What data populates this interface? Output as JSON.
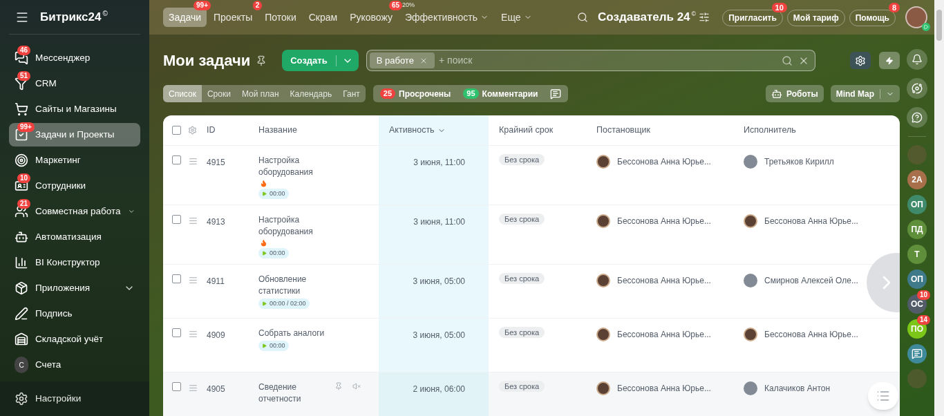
{
  "sidebar": {
    "logo": "Битрикс24",
    "logo_mark": "©",
    "items": [
      {
        "label": "Мессенджер",
        "badge": "46",
        "selected": false,
        "expandable": false
      },
      {
        "label": "CRM",
        "badge": "51",
        "selected": false,
        "expandable": false
      },
      {
        "label": "Сайты и Магазины",
        "selected": false,
        "expandable": false
      },
      {
        "label": "Задачи и Проекты",
        "badge": "99+",
        "selected": true,
        "expandable": false
      },
      {
        "label": "Маркетинг",
        "selected": false,
        "expandable": false
      },
      {
        "label": "Сотрудники",
        "badge": "10",
        "selected": false,
        "expandable": false
      },
      {
        "label": "Совместная работа",
        "badge": "21",
        "selected": false,
        "expandable": true
      },
      {
        "label": "Автоматизация",
        "selected": false,
        "expandable": false
      },
      {
        "label": "BI Конструктор",
        "selected": false,
        "expandable": false
      },
      {
        "label": "Приложения",
        "selected": false,
        "expandable": true
      },
      {
        "label": "Подпись",
        "selected": false,
        "expandable": false
      },
      {
        "label": "Складской учёт",
        "selected": false,
        "expandable": false
      },
      {
        "letter": "С",
        "label": "Счета",
        "selected": false,
        "expandable": false
      }
    ],
    "settings": "Настройки"
  },
  "topnav": {
    "tabs": [
      {
        "label": "Задачи",
        "badge": "99+",
        "selected": true,
        "dropdown": false
      },
      {
        "label": "Проекты",
        "badge": "2",
        "selected": false,
        "dropdown": false
      },
      {
        "label": "Потоки",
        "selected": false,
        "dropdown": false
      },
      {
        "label": "Скрам",
        "selected": false,
        "dropdown": false
      },
      {
        "label": "Руковожу",
        "badge": "65",
        "selected": false,
        "dropdown": false
      },
      {
        "label": "Эффективность",
        "note": "20%",
        "selected": false,
        "dropdown": true
      },
      {
        "label": "Еще",
        "selected": false,
        "dropdown": true
      }
    ],
    "company": "Создаватель 24",
    "company_mark": "©",
    "buttons": [
      {
        "label": "Пригласить",
        "badge": "10"
      },
      {
        "label": "Мой тариф"
      },
      {
        "label": "Помощь",
        "badge": "8"
      }
    ]
  },
  "toolbar": {
    "title": "Мои задачи",
    "create": "Создать",
    "filter_chip": "В работе",
    "search_add": "+",
    "search": {
      "placeholder": "поиск"
    },
    "views": [
      {
        "label": "Список",
        "selected": true
      },
      {
        "label": "Сроки",
        "selected": false
      },
      {
        "label": "Мой план",
        "selected": false
      },
      {
        "label": "Календарь",
        "selected": false
      },
      {
        "label": "Гант",
        "selected": false
      }
    ],
    "counters": [
      {
        "count": "25",
        "label": "Просрочены",
        "color": "#f0433f"
      },
      {
        "count": "95",
        "label": "Комментарии",
        "color": "#2fc26e"
      }
    ],
    "robots": "Роботы",
    "mind_map": "Mind Map"
  },
  "table": {
    "select_all": {
      "checked": false
    },
    "columns": [
      {
        "label": "ID",
        "sorted": false
      },
      {
        "label": "Название",
        "sorted": false
      },
      {
        "label": "Активность",
        "sorted": true
      },
      {
        "label": "Крайний срок",
        "sorted": false
      },
      {
        "label": "Постановщик",
        "sorted": false
      },
      {
        "label": "Исполнитель",
        "sorted": false
      }
    ],
    "rows": [
      {
        "checked": false,
        "id": "4915",
        "title": "Настройка оборудования",
        "hot": true,
        "timer": "00:00",
        "activity": "3 июня, 11:00",
        "deadline": "Без срока",
        "creator": {
          "name": "Бессонова Анна Юрье...",
          "photo": true
        },
        "assignee": {
          "name": "Третьяков Кирилл",
          "photo": false
        },
        "highlighted": false
      },
      {
        "checked": false,
        "id": "4913",
        "title": "Настройка оборудования",
        "hot": true,
        "timer": "00:00",
        "activity": "3 июня, 11:00",
        "deadline": "Без срока",
        "creator": {
          "name": "Бессонова Анна Юрье...",
          "photo": true
        },
        "assignee": {
          "name": "Бессонова Анна Юрье...",
          "photo": true
        },
        "highlighted": false
      },
      {
        "checked": false,
        "id": "4911",
        "title": "Обновление статистики",
        "hot": false,
        "timer": "00:00 / 02:00",
        "activity": "3 июня, 05:00",
        "deadline": "Без срока",
        "creator": {
          "name": "Бессонова Анна Юрье...",
          "photo": true
        },
        "assignee": {
          "name": "Смирнов Алексей Оле...",
          "photo": false
        },
        "highlighted": false
      },
      {
        "checked": false,
        "id": "4909",
        "title": "Собрать аналоги",
        "hot": false,
        "timer": "00:00",
        "activity": "3 июня, 05:00",
        "deadline": "Без срока",
        "creator": {
          "name": "Бессонова Анна Юрье...",
          "photo": true
        },
        "assignee": {
          "name": "Бессонова Анна Юрье...",
          "photo": true
        },
        "highlighted": false
      },
      {
        "checked": false,
        "id": "4905",
        "title": "Сведение отчетности",
        "hot": false,
        "activity": "2 июня, 06:00",
        "deadline": "Без срока",
        "creator": {
          "name": "Бессонова Анна Юрье...",
          "photo": true
        },
        "assignee": {
          "name": "Калачиков Антон",
          "photo": false
        },
        "highlighted": true
      }
    ]
  },
  "rail": [
    {
      "kind": "photo"
    },
    {
      "kind": "initials",
      "text": "2А",
      "color": "#a8704a"
    },
    {
      "kind": "initials",
      "text": "ОП",
      "color": "#3f8a6a"
    },
    {
      "kind": "initials",
      "text": "ПД",
      "color": "#5f8f3a"
    },
    {
      "kind": "initials",
      "text": "Т",
      "color": "#5f8f3a"
    },
    {
      "kind": "initials",
      "text": "ОП",
      "color": "#3f7a8a"
    },
    {
      "kind": "initials",
      "text": "ОС",
      "color": "#525c69",
      "badge": "10"
    },
    {
      "kind": "initials",
      "text": "ПО",
      "color": "#7bc618",
      "badge": "14"
    },
    {
      "kind": "chat",
      "color": "#3f8a9a"
    },
    {
      "kind": "photo"
    }
  ]
}
